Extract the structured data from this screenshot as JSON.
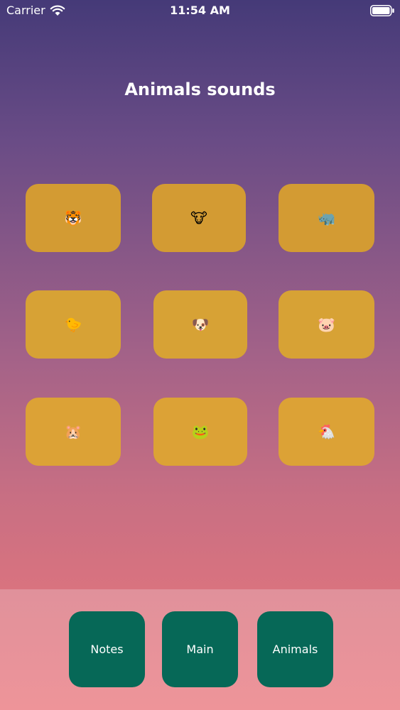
{
  "status_bar": {
    "carrier": "Carrier",
    "time": "11:54 AM"
  },
  "title": "Animals sounds",
  "tiles": [
    {
      "emoji": "🐯",
      "icon": "tiger-icon"
    },
    {
      "emoji": "🐮",
      "icon": "cow-icon"
    },
    {
      "emoji": "🦏",
      "icon": "rhinoceros-icon"
    },
    {
      "emoji": "🐤",
      "icon": "chick-icon"
    },
    {
      "emoji": "🐶",
      "icon": "dog-icon"
    },
    {
      "emoji": "🐷",
      "icon": "pig-icon"
    },
    {
      "emoji": "🐹",
      "icon": "hamster-icon"
    },
    {
      "emoji": "🐸",
      "icon": "frog-icon"
    },
    {
      "emoji": "🐔",
      "icon": "chicken-icon"
    }
  ],
  "tabs": [
    {
      "label": "Notes"
    },
    {
      "label": "Main"
    },
    {
      "label": "Animals"
    }
  ],
  "colors": {
    "tile": "#d39b33",
    "tab_button": "#066857",
    "gradient_top": "#453a78",
    "gradient_bottom": "#d9737f",
    "bottom_panel": "#e0919b"
  }
}
